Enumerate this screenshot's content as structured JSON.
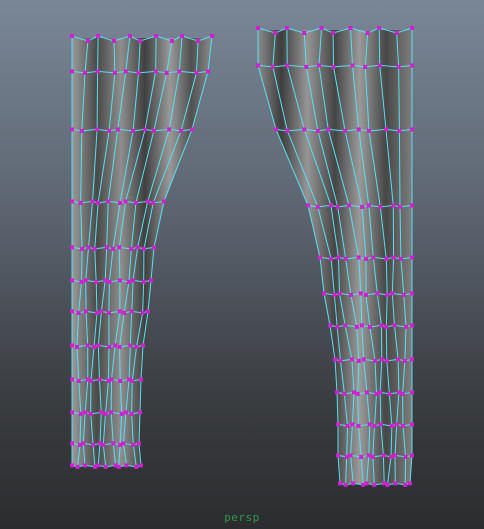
{
  "viewport": {
    "camera_name": "persp",
    "colors": {
      "background_top": "#7a8797",
      "background_bottom": "#2b2c2e",
      "wire": "#58e0f0",
      "vertex": "#d21ed2",
      "surface_light": "#8a8a8a",
      "surface_dark": "#3c3c3c",
      "camera_label": "#2d9a52"
    },
    "objects": [
      {
        "name": "curtain-left",
        "selected": true
      },
      {
        "name": "curtain-right",
        "selected": true
      }
    ]
  }
}
